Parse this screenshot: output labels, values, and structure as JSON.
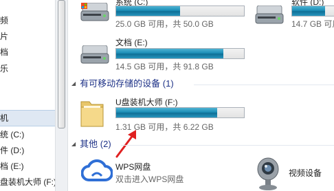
{
  "nav_pane": {
    "items": [
      {
        "label": "频"
      },
      {
        "label": "片"
      },
      {
        "label": "档"
      },
      {
        "label": "乐"
      },
      {
        "label": "机",
        "selected": true
      },
      {
        "label": "统 (C:)"
      },
      {
        "label": "件 (D:)"
      },
      {
        "label": "档 (E:)"
      },
      {
        "label": "盘装机大师 (F:)"
      }
    ]
  },
  "hard_drives": [
    {
      "name": "系统 (C:)",
      "info": "25.0 GB 可用，共 50.0 GB",
      "used_fraction": 0.5
    },
    {
      "name": "软件 (D:)",
      "info": "14.7 GB 可用，共",
      "used_fraction": 0.6
    },
    {
      "name": "文档 (E:)",
      "info": "14.5 GB 可用，共 91.8 GB",
      "used_fraction": 0.84
    }
  ],
  "removable_group": {
    "title": "有可移动存储的设备 (1)",
    "drives": [
      {
        "name": "U盘装机大师 (F:)",
        "info": "1.31 GB 可用，共 6.22 GB",
        "used_fraction": 0.79
      }
    ]
  },
  "other_group": {
    "title": "其他 (2)",
    "items": [
      {
        "name": "WPS网盘",
        "subtitle": "双击进入WPS网盘"
      },
      {
        "name": "视频设备"
      }
    ]
  },
  "colors": {
    "bar_fill": "#1b8db6",
    "group_title": "#1e3287",
    "annotation_arrow": "#e02020"
  }
}
